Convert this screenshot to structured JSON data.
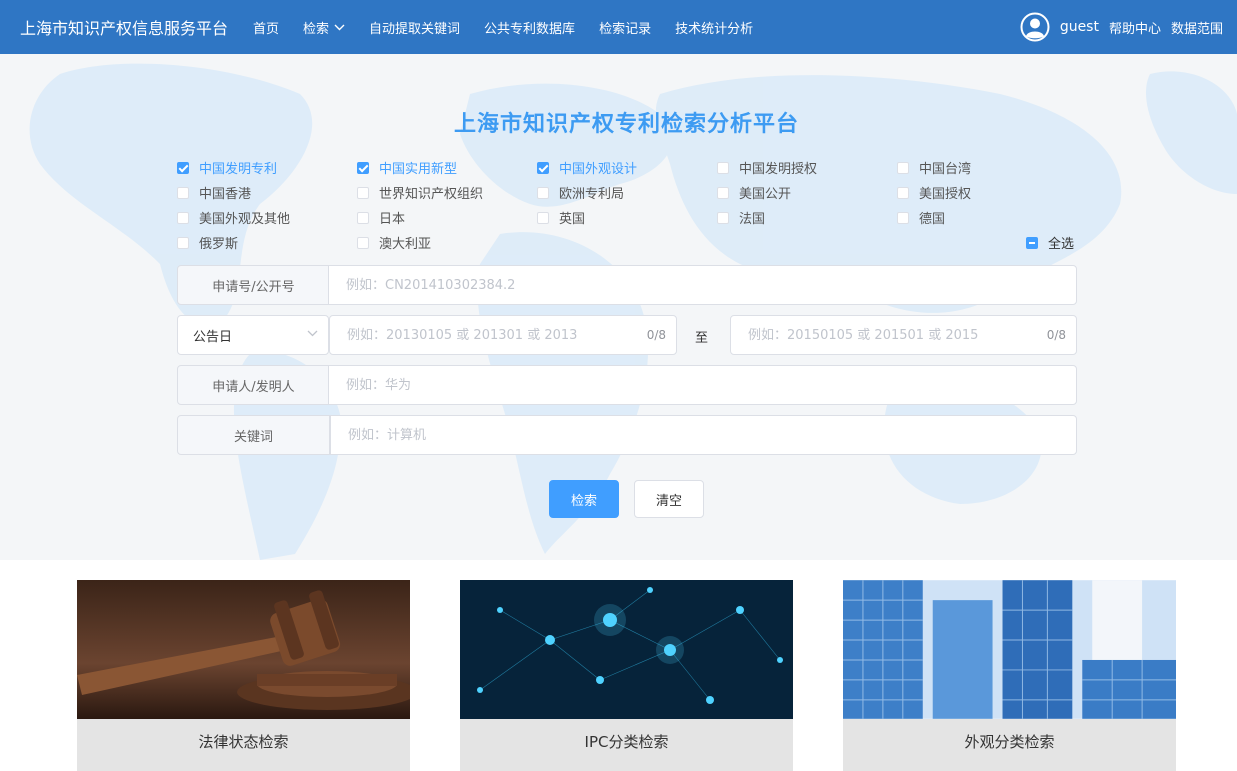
{
  "header": {
    "brand": "上海市知识产权信息服务平台",
    "nav": [
      "首页",
      "检索",
      "自动提取关键词",
      "公共专利数据库",
      "检索记录",
      "技术统计分析"
    ],
    "user": "guest",
    "help": "帮助中心",
    "data_scope": "数据范围"
  },
  "hero": {
    "title": "上海市知识产权专利检索分析平台",
    "checkboxes": [
      {
        "label": "中国发明专利",
        "checked": true
      },
      {
        "label": "中国实用新型",
        "checked": true
      },
      {
        "label": "中国外观设计",
        "checked": true
      },
      {
        "label": "中国发明授权",
        "checked": false
      },
      {
        "label": "中国台湾",
        "checked": false
      },
      {
        "label": "中国香港",
        "checked": false
      },
      {
        "label": "世界知识产权组织",
        "checked": false
      },
      {
        "label": "欧洲专利局",
        "checked": false
      },
      {
        "label": "美国公开",
        "checked": false
      },
      {
        "label": "美国授权",
        "checked": false
      },
      {
        "label": "美国外观及其他",
        "checked": false
      },
      {
        "label": "日本",
        "checked": false
      },
      {
        "label": "英国",
        "checked": false
      },
      {
        "label": "法国",
        "checked": false
      },
      {
        "label": "德国",
        "checked": false
      },
      {
        "label": "俄罗斯",
        "checked": false
      },
      {
        "label": "澳大利亚",
        "checked": false
      }
    ],
    "select_all": "全选"
  },
  "form": {
    "app_no": {
      "label": "申请号/公开号",
      "placeholder": "例如：CN201410302384.2"
    },
    "date": {
      "type_selected": "公告日",
      "from_placeholder": "例如：20130105 或 201301 或 2013",
      "from_count": "0/8",
      "to_label": "至",
      "to_placeholder": "例如：20150105 或 201501 或 2015",
      "to_count": "0/8"
    },
    "applicant": {
      "label": "申请人/发明人",
      "placeholder": "例如：华为"
    },
    "keyword": {
      "label": "关键词",
      "placeholder": "例如：计算机"
    },
    "search_btn": "检索",
    "clear_btn": "清空"
  },
  "cards": [
    {
      "caption": "法律状态检索"
    },
    {
      "caption": "IPC分类检索"
    },
    {
      "caption": "外观分类检索"
    }
  ]
}
